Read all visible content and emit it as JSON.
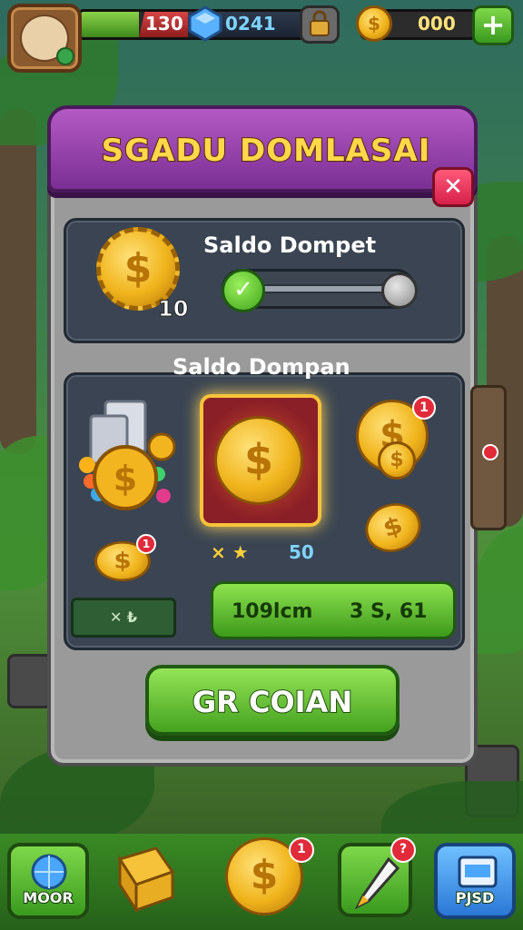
{
  "hud": {
    "hp_value": "130",
    "gem_value": "0241",
    "coin_value": "000",
    "plus_label": "+"
  },
  "modal": {
    "title": "SGADU DOMLASAI",
    "close_label": "✕",
    "wallet_label": "Saldo Dompet",
    "wallet_count": "10",
    "section_label": "Saldo Dompan",
    "rating_text": "⨯ ★",
    "rating_value": "50",
    "stat_small": "✕ ₺",
    "stat_left": "109lcm",
    "stat_right": "3 S, 61",
    "action_button": "GR COIAN"
  },
  "badges": {
    "coin_badge": "1",
    "small_coin_badge": "1",
    "bottom_coin_badge": "1",
    "bottom_pen_badge": "?"
  },
  "bottom_nav": {
    "left_label": "MOOR",
    "right_label": "PJSD"
  },
  "colors": {
    "header_purple": "#8e3ea6",
    "title_gold": "#ffd84a",
    "green_button": "#5cc02c",
    "close_red": "#e33a5f"
  },
  "icons": [
    "avatar-icon",
    "gem-icon",
    "lock-icon",
    "coin-icon",
    "plus-icon",
    "close-icon",
    "check-icon",
    "pen-icon",
    "box-icon"
  ]
}
